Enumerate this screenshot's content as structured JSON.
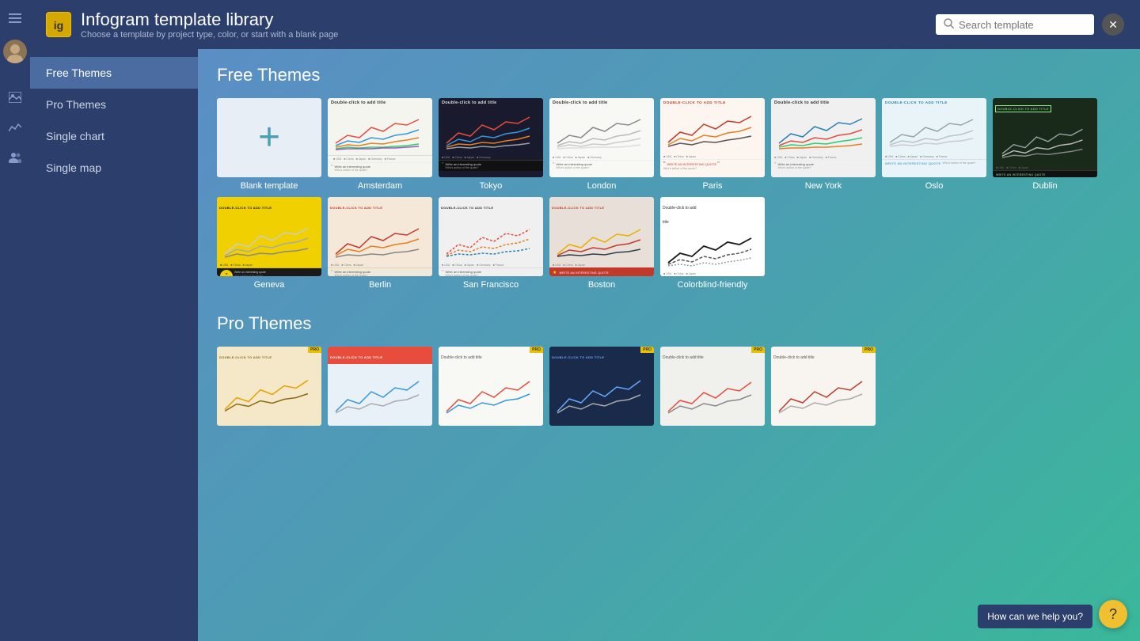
{
  "app": {
    "title": "Infogram template library",
    "subtitle": "Choose a template by project type, color, or start with a blank page",
    "logo_text": "ig"
  },
  "search": {
    "placeholder": "Search template"
  },
  "nav": {
    "items": [
      {
        "id": "free-themes",
        "label": "Free Themes",
        "active": true
      },
      {
        "id": "pro-themes",
        "label": "Pro Themes",
        "active": false
      },
      {
        "id": "single-chart",
        "label": "Single chart",
        "active": false
      },
      {
        "id": "single-map",
        "label": "Single map",
        "active": false
      }
    ]
  },
  "sections": {
    "free_themes": {
      "title": "Free Themes",
      "templates": [
        {
          "id": "blank",
          "name": "Blank template",
          "type": "blank"
        },
        {
          "id": "amsterdam",
          "name": "Amsterdam",
          "theme": "amsterdam"
        },
        {
          "id": "tokyo",
          "name": "Tokyo",
          "theme": "tokyo"
        },
        {
          "id": "london",
          "name": "London",
          "theme": "london"
        },
        {
          "id": "paris",
          "name": "Paris",
          "theme": "paris"
        },
        {
          "id": "newyork",
          "name": "New York",
          "theme": "newyork"
        },
        {
          "id": "oslo",
          "name": "Oslo",
          "theme": "oslo"
        },
        {
          "id": "dublin",
          "name": "Dublin",
          "theme": "dublin"
        },
        {
          "id": "geneva",
          "name": "Geneva",
          "theme": "geneva"
        },
        {
          "id": "berlin",
          "name": "Berlin",
          "theme": "berlin"
        },
        {
          "id": "sanfrancisco",
          "name": "San Francisco",
          "theme": "sanfrancisco"
        },
        {
          "id": "boston",
          "name": "Boston",
          "theme": "boston"
        },
        {
          "id": "colorblind",
          "name": "Colorblind-friendly",
          "theme": "colorblind"
        }
      ]
    },
    "pro_themes": {
      "title": "Pro Themes"
    }
  },
  "help": {
    "text": "How can we help you?"
  },
  "sidebar_icons": [
    {
      "id": "menu",
      "symbol": "☰"
    },
    {
      "id": "avatar",
      "symbol": "A"
    },
    {
      "id": "image",
      "symbol": "🖼"
    },
    {
      "id": "chart",
      "symbol": "📊"
    },
    {
      "id": "users",
      "symbol": "👥"
    }
  ]
}
